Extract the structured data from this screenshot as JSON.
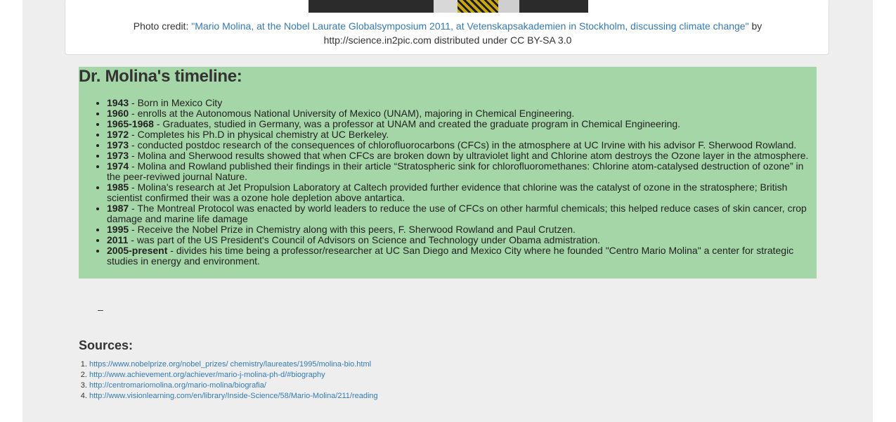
{
  "photo_credit": {
    "prefix": "Photo credit: ",
    "link_text": "\"Mario Molina, at the Nobel Laurate Globalsymposium 2011, at Vetenskapsakademien in Stockholm, discussing climate change\"",
    "suffix_line1": " by",
    "line2": "http://science.in2pic.com distributed under CC BY-SA 3.0"
  },
  "timeline": {
    "heading": "Dr. Molina's timeline:",
    "items": [
      {
        "year": "1943",
        "text": " - Born in Mexico City"
      },
      {
        "year": "1960",
        "text": " - enrolls at the Autonomous National University of Mexico (UNAM), majoring in Chemical Engineering."
      },
      {
        "year": "1965-1968",
        "text": " - Graduates, studied in Germany, was a professor at UNAM and created the graduate program in Chemical Engineering."
      },
      {
        "year": "1972",
        "text": " - Completes his Ph.D in physical chemistry at UC Berkeley."
      },
      {
        "year": "1973",
        "text": " - conducted postdoc research of the consequences of chlorofluorocarbons (CFCs) in the atmosphere at UC Irvine with his advisor F. Sherwood Rowland."
      },
      {
        "year": "1973",
        "text": " - Molina and Sherwood results showed that when CFCs are broken down by ultraviolet light and Chlorine atom destroys the Ozone layer in the atmosphere."
      },
      {
        "year": "1974",
        "text": " - Molina and Rowland published their findings in their article “Stratospheric sink for chlorofluoromethanes: Chlorine atom-catalysed destruction of ozone” in the peer-reviwed journal Nature."
      },
      {
        "year": "1985",
        "text": " - Molina's research at Jet Propulsion Laboratory at Caltech provided further evidence that chlorine was the catalyst of ozone in the stratosphere; British scientist confirmed their was a ozone hole depletion above antartica."
      },
      {
        "year": "1987",
        "text": " - The Montreal Protocol was enacted by world leaders to reduce the use of CFCs on other harmful chemicals; this helped reduce cases of skin cancer, crop damage and marine life damage"
      },
      {
        "year": "1995",
        "text": " - Receive the Nobel Prize in Chemistry along with this peers, F. Sherwood Rowland and Paul Crutzen."
      },
      {
        "year": "2011",
        "text": " - was part of the US President's Council of Advisors on Science and Technology under Obama admistration."
      },
      {
        "year": "2005-present",
        "text": " - divides his time being a professor/researcher at UC San Diego and Mexico City where he founded \"Centro Mario Molina\" a center for strategic studies in energy and environment."
      }
    ]
  },
  "separator": "–",
  "sources": {
    "heading": "Sources:",
    "links": [
      "https://www.nobelprize.org/nobel_prizes/ chemistry/laureates/1995/molina-bio.html",
      "http://www.achievement.org/achiever/mario-j-molina-ph-d/#biography",
      "http://centromariomolina.org/mario-molina/biografia/",
      "http://www.visionlearning.com/en/library/Inside-Science/58/Mario-Molina/211/reading"
    ]
  },
  "colors": {
    "timeline_bg": "#a5d6a7",
    "link": "#337ab7",
    "page_bg": "#eeeeee"
  }
}
